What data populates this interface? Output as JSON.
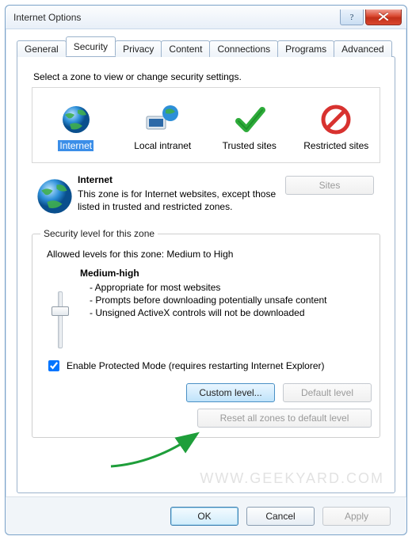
{
  "title": "Internet Options",
  "tabs": [
    "General",
    "Security",
    "Privacy",
    "Content",
    "Connections",
    "Programs",
    "Advanced"
  ],
  "active_tab_index": 1,
  "instruction": "Select a zone to view or change security settings.",
  "zones": [
    {
      "name": "Internet",
      "selected": true
    },
    {
      "name": "Local intranet",
      "selected": false
    },
    {
      "name": "Trusted sites",
      "selected": false
    },
    {
      "name": "Restricted sites",
      "selected": false
    }
  ],
  "zone_desc": {
    "title": "Internet",
    "body": "This zone is for Internet websites, except those listed in trusted and restricted zones."
  },
  "sites_button": "Sites",
  "group_legend": "Security level for this zone",
  "allowed_levels": "Allowed levels for this zone: Medium to High",
  "level": {
    "title": "Medium-high",
    "lines": [
      "- Appropriate for most websites",
      "- Prompts before downloading potentially unsafe content",
      "- Unsigned ActiveX controls will not be downloaded"
    ]
  },
  "protected_mode": {
    "checked": true,
    "label": "Enable Protected Mode (requires restarting Internet Explorer)"
  },
  "buttons": {
    "custom_level": "Custom level...",
    "default_level": "Default level",
    "reset_all": "Reset all zones to default level",
    "ok": "OK",
    "cancel": "Cancel",
    "apply": "Apply"
  },
  "watermark": "WWW.GEEKYARD.COM"
}
